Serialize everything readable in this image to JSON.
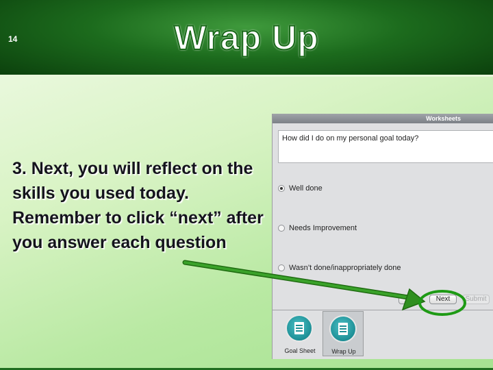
{
  "slide": {
    "number": "14",
    "title": "Wrap Up",
    "body": "3. Next, you will reflect on the skills you used today. Remember to click  “next” after you answer each question"
  },
  "window": {
    "title": "Worksheets",
    "question": "How did I do on my personal goal today?",
    "options": [
      {
        "label": "Well done",
        "checked": true
      },
      {
        "label": "Needs Improvement",
        "checked": false
      },
      {
        "label": "Wasn’t done/inappropriately done",
        "checked": false
      }
    ],
    "buttons": {
      "next": "Next",
      "submit": "Submit"
    },
    "tabs": [
      {
        "label": "Goal Sheet",
        "icon": "worksheet-icon"
      },
      {
        "label": "Wrap  Up",
        "icon": "worksheet-icon"
      }
    ]
  },
  "colors": {
    "header_green": "#1c6b1d",
    "arrow_green": "#2f8f1f",
    "highlight_green": "#1e9a15"
  }
}
